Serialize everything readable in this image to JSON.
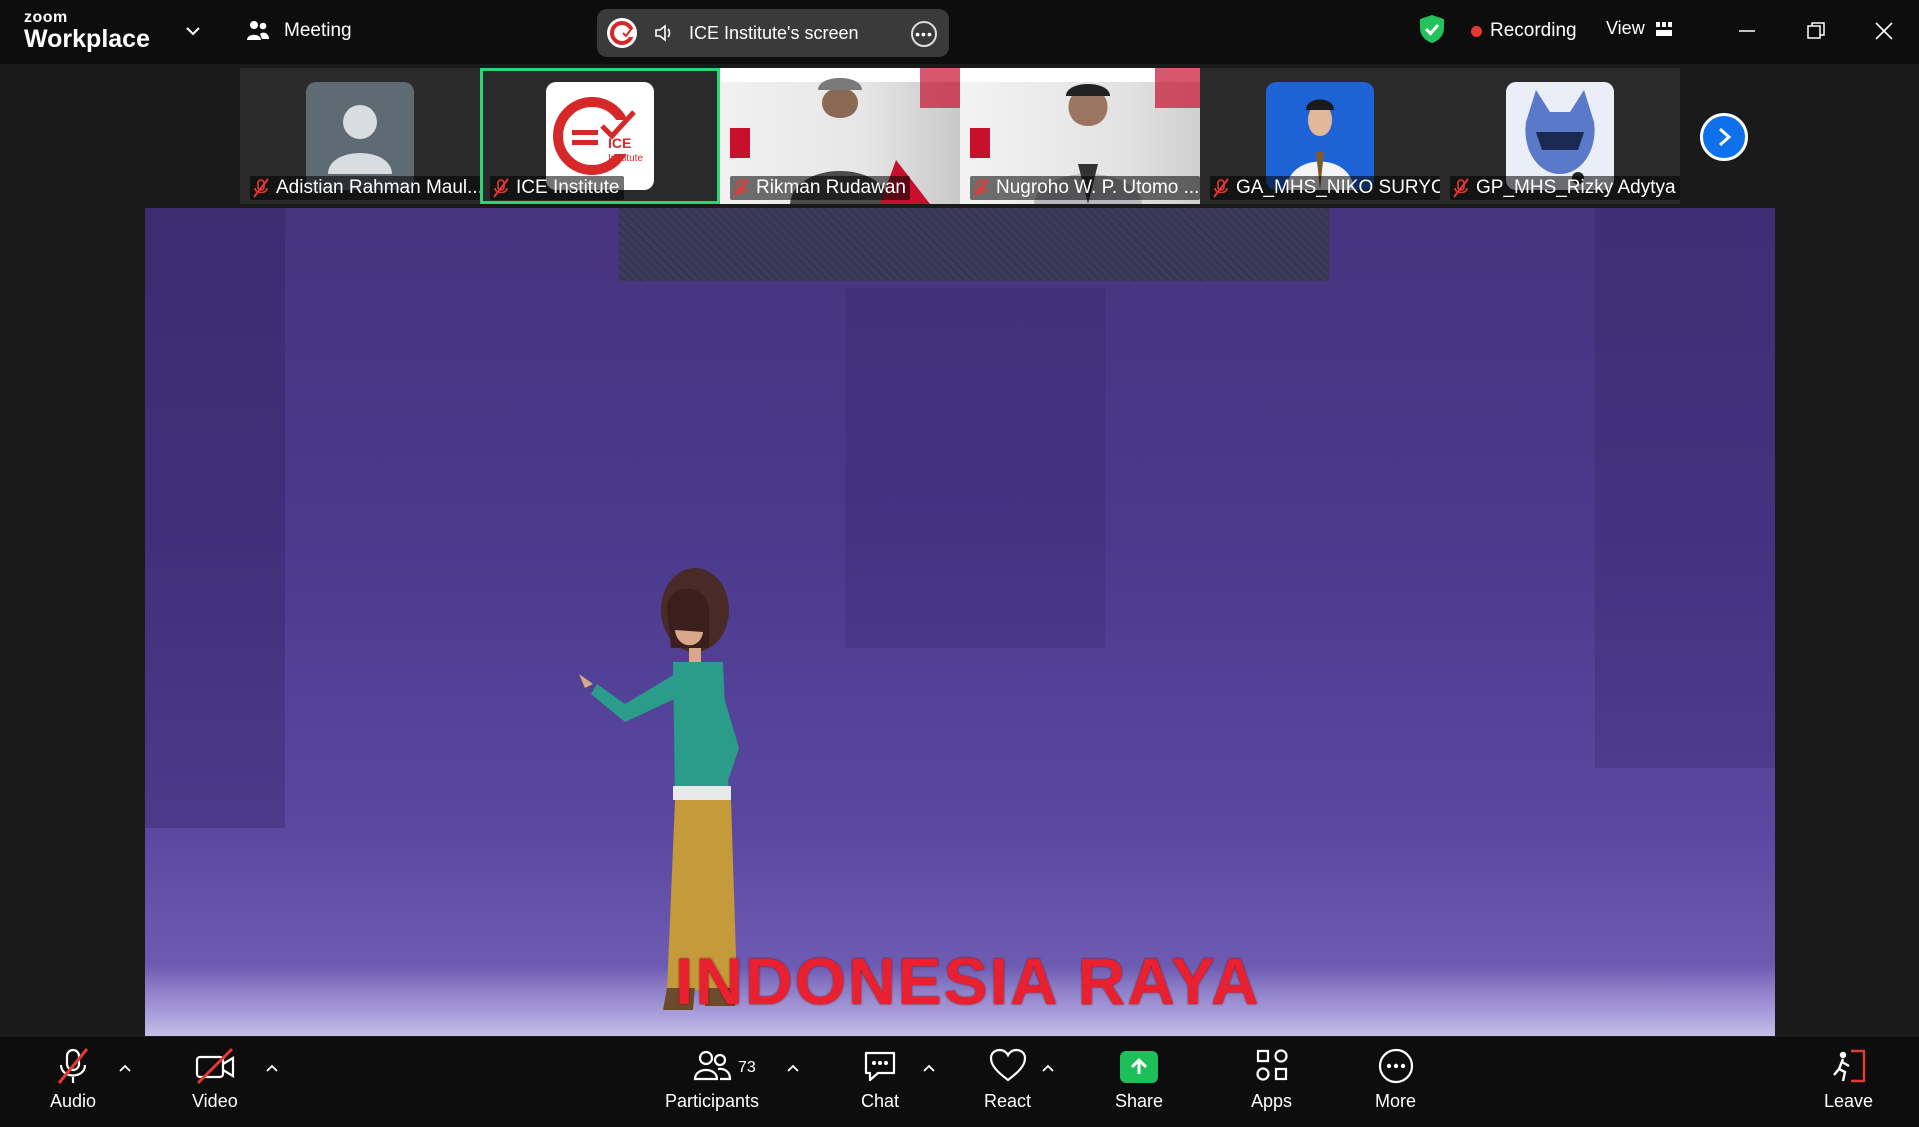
{
  "app": {
    "brand_small": "zoom",
    "brand_big": "Workplace"
  },
  "header": {
    "meeting_label": "Meeting",
    "share_title": "ICE Institute's screen",
    "recording_label": "Recording",
    "view_label": "View"
  },
  "participants_strip": [
    {
      "name": "Adistian Rahman Maul...",
      "avatar": "generic-person-icon"
    },
    {
      "name": "ICE Institute",
      "avatar": "ice-institute-logo",
      "active": true
    },
    {
      "name": "Rikman Rudawan",
      "avatar": "video-feed"
    },
    {
      "name": "Nugroho W. P. Utomo ...",
      "avatar": "video-feed"
    },
    {
      "name": "GA_MHS_NIKO SURYO P",
      "avatar": "profile-photo"
    },
    {
      "name": "GP_MHS_Rizky Adytya ...",
      "avatar": "cartoon-avatar"
    }
  ],
  "logo_text": {
    "line1": "ICE",
    "line2": "Institute"
  },
  "shared_screen": {
    "caption": "INDONESIA RAYA"
  },
  "toolbar": {
    "audio": "Audio",
    "video": "Video",
    "participants": "Participants",
    "participants_count": "73",
    "chat": "Chat",
    "react": "React",
    "share": "Share",
    "apps": "Apps",
    "more": "More",
    "leave": "Leave"
  },
  "colors": {
    "active_tile": "#2ed573",
    "leave_red": "#e53935",
    "share_green": "#1dbf5a",
    "next_blue": "#0e71eb",
    "caption_red": "#e8202f"
  }
}
